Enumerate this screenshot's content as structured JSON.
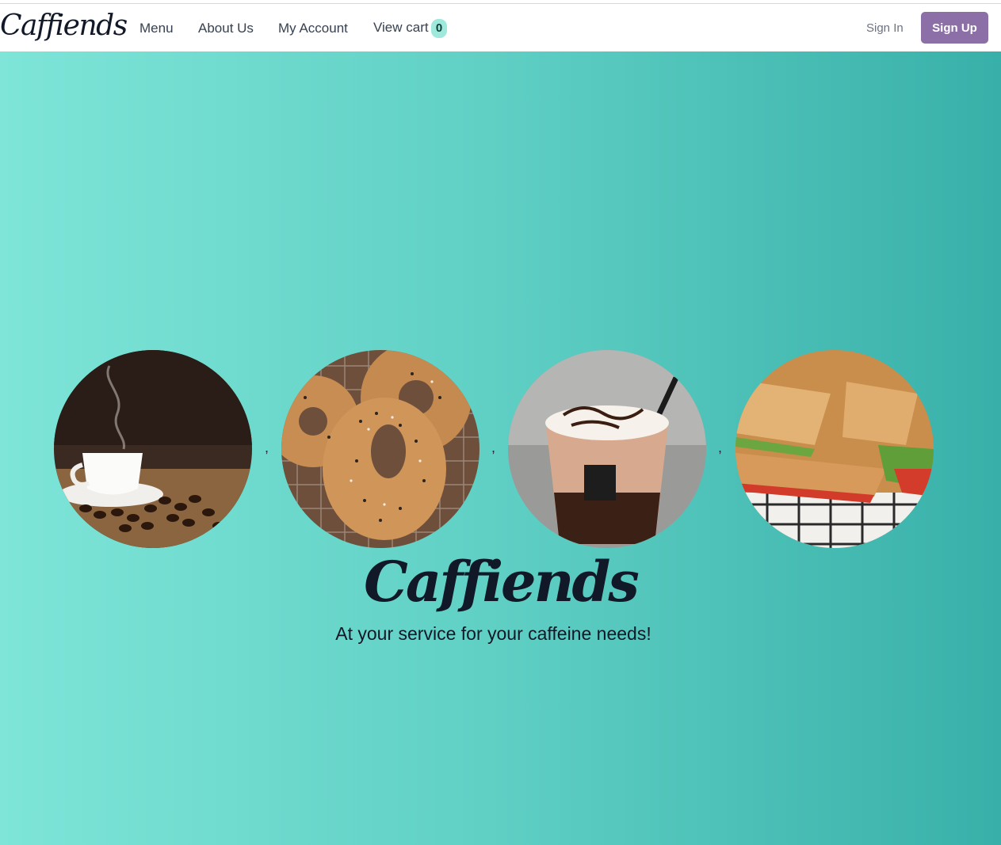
{
  "brand": {
    "logo_text": "Caffiends"
  },
  "nav": {
    "links": [
      "Menu",
      "About Us",
      "My Account"
    ],
    "cart_label": "View cart",
    "cart_count": "0",
    "signin_label": "Sign In",
    "signup_label": "Sign Up"
  },
  "hero": {
    "title": "Caffiends",
    "tagline": "At your service for your caffeine needs!",
    "separator": ",",
    "photos": [
      "coffee-cup-image",
      "bagel-image",
      "iced-mocha-image",
      "sandwich-image"
    ]
  },
  "colors": {
    "accent": "#8b6fa6",
    "hero_gradient_start": "#7ee5d8",
    "hero_gradient_end": "#38b0a9",
    "badge": "#9ee9dc"
  }
}
